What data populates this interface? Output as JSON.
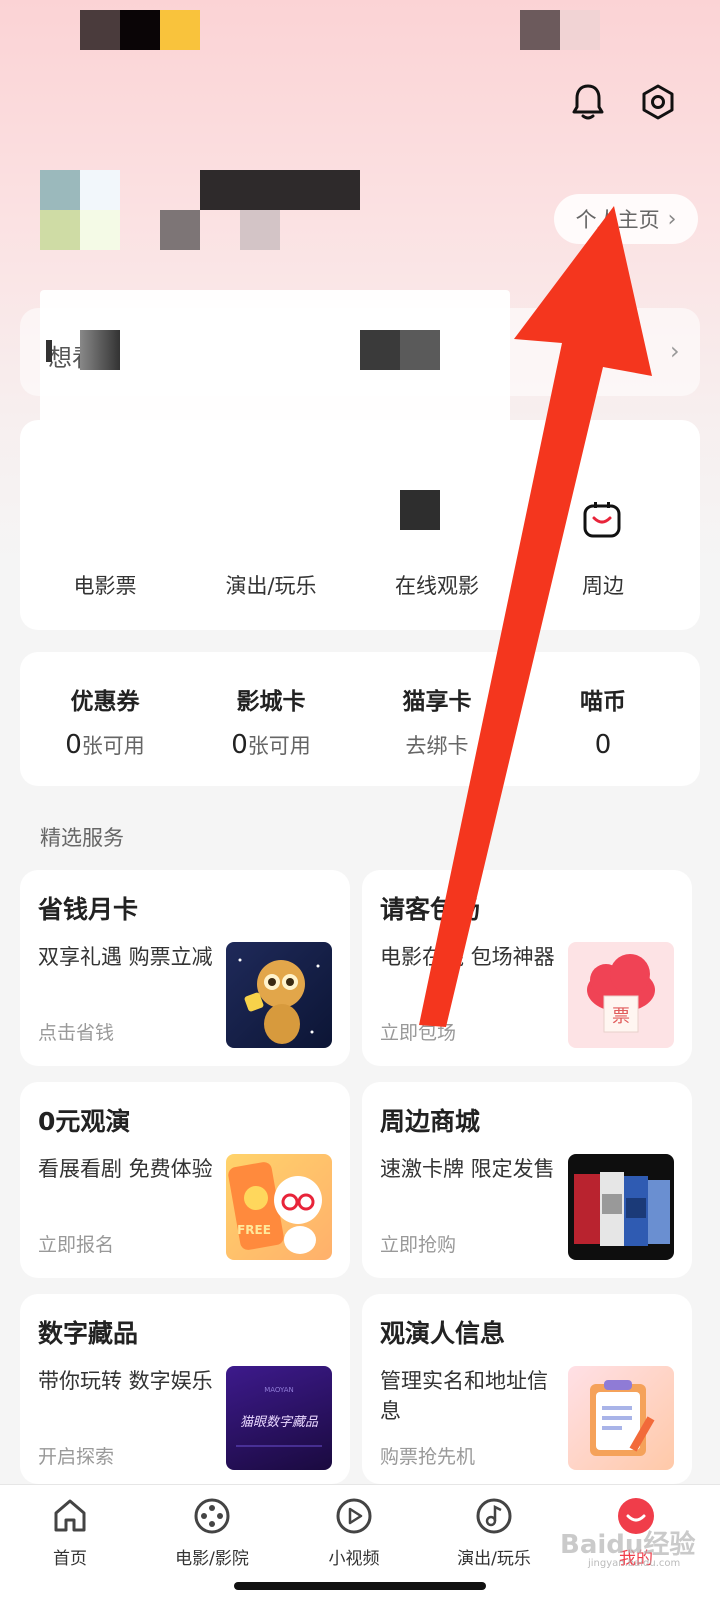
{
  "header": {
    "profile_link_label": "个人主页",
    "profile_link_arrow": "›"
  },
  "wish": {
    "label": "想看",
    "arrow": "›"
  },
  "entertainment": {
    "items": [
      {
        "label": "电影票"
      },
      {
        "label": "演出/玩乐"
      },
      {
        "label": "在线观影"
      },
      {
        "label": "周边"
      }
    ]
  },
  "wallet": {
    "items": [
      {
        "title": "优惠券",
        "count": "0",
        "unit": "张可用"
      },
      {
        "title": "影城卡",
        "count": "0",
        "unit": "张可用"
      },
      {
        "title": "猫享卡",
        "count": "",
        "unit": "去绑卡"
      },
      {
        "title": "喵币",
        "count": "0",
        "unit": ""
      }
    ]
  },
  "services": {
    "section_title": "精选服务",
    "items": [
      {
        "title": "省钱月卡",
        "desc": "双享礼遇 购票立减",
        "action": "点击省钱"
      },
      {
        "title": "请客包场",
        "desc": "电影在线 包场神器",
        "action": "立即包场"
      },
      {
        "title": "0元观演",
        "desc": "看展看剧 免费体验",
        "action": "立即报名"
      },
      {
        "title": "周边商城",
        "desc": "速激卡牌 限定发售",
        "action": "立即抢购"
      },
      {
        "title": "数字藏品",
        "desc": "带你玩转 数字娱乐",
        "action": "开启探索"
      },
      {
        "title": "观演人信息",
        "desc": "管理实名和地址信息",
        "action": "购票抢先机"
      }
    ],
    "image_texts": {
      "free": "FREE",
      "ticket": "票",
      "digital": "猫眼数字藏品",
      "digital_brand": "MAOYAN"
    }
  },
  "tabbar": {
    "items": [
      {
        "label": "首页"
      },
      {
        "label": "电影/影院"
      },
      {
        "label": "小视频"
      },
      {
        "label": "演出/玩乐"
      },
      {
        "label": "我的"
      }
    ]
  },
  "watermark": {
    "main": "Baidu经验",
    "sub": "jingyan.baidu.com"
  },
  "colors": {
    "accent": "#f03d4a",
    "arrow": "#f4361e",
    "header_bg": "#fbd3d5"
  }
}
